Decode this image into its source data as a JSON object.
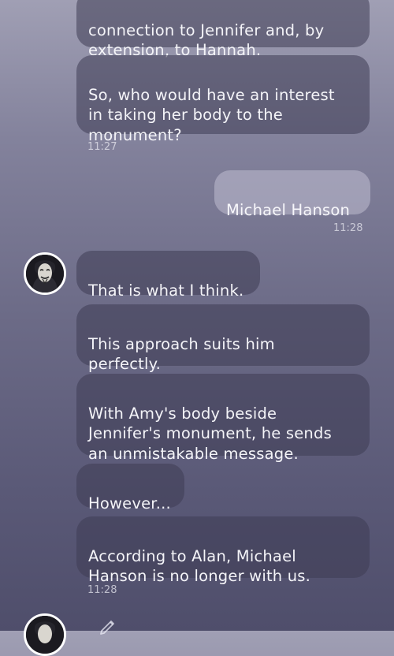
{
  "conversation": {
    "messages": [
      {
        "text": "connection to Jennifer and, by\nextension, to Hannah."
      },
      {
        "text": "So, who would have an interest\nin taking her body to the\nmonument?"
      },
      {
        "text": "Michael Hanson"
      },
      {
        "text": "That is what I think."
      },
      {
        "text": "This approach suits him\nperfectly."
      },
      {
        "text": "With Amy's body beside\nJennifer's monument, he sends\nan unmistakable message."
      },
      {
        "text": "However..."
      },
      {
        "text": "According to Alan, Michael\nHanson is no longer with us."
      }
    ],
    "timestamps": [
      "11:27",
      "11:28",
      "11:28"
    ]
  },
  "icons": {
    "avatar": "anonymous-mask-avatar",
    "typing": "pencil-icon"
  },
  "colors": {
    "incoming_bubble": "#4a4862",
    "outgoing_bubble": "#b9b8cc",
    "text": "#f4f4f8",
    "timestamp": "#d8d8e4"
  }
}
